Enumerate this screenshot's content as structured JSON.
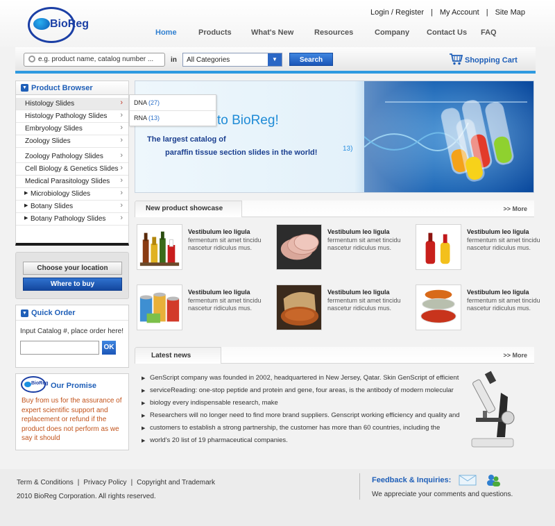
{
  "logo": {
    "text": "BioReg"
  },
  "header": {
    "toplinks": [
      "Login / Register",
      "My Account",
      "Site Map"
    ],
    "nav": [
      "Home",
      "Products",
      "What's New",
      "Resources",
      "Company",
      "Contact Us",
      "FAQ"
    ],
    "active_nav": "Home"
  },
  "search": {
    "placeholder": "e.g. product name, catalog number ...",
    "in_label": "in",
    "category_selected": "All Categories",
    "button_label": "Search"
  },
  "cart": {
    "label": "Shopping Cart"
  },
  "product_browser": {
    "title": "Product Browser",
    "items": [
      {
        "label": "Histology Slides",
        "bullet": false,
        "highlighted": true
      },
      {
        "label": "Histology Pathology Slides",
        "bullet": false
      },
      {
        "label": "Embryology Slides",
        "bullet": false
      },
      {
        "label": "Zoology Slides",
        "bullet": false
      },
      {
        "label": "Zoology Pathology Slides",
        "bullet": false
      },
      {
        "label": "Cell Biology & Genetics Slides",
        "bullet": false
      },
      {
        "label": "Medical Parasitology Slides",
        "bullet": false
      },
      {
        "label": "Microbiology Slides",
        "bullet": true
      },
      {
        "label": "Botany Slides",
        "bullet": true
      },
      {
        "label": "Botany Pathology Slides",
        "bullet": true
      }
    ],
    "flyout": [
      {
        "label": "DNA",
        "count": "(27)"
      },
      {
        "label": "RNA",
        "count": "(13)"
      }
    ]
  },
  "location": {
    "choose_label": "Choose your location",
    "where_label": "Where to buy"
  },
  "quick_order": {
    "title": "Quick Order",
    "instruction": "Input Catalog #, place order here!",
    "ok_label": "OK"
  },
  "promise": {
    "logo_text": "BioReg",
    "title": "Our Promise",
    "text": "Buy from us for the assurance of expert scientific support and replacement or refund if the product does not perform as we say it should"
  },
  "banner": {
    "title": "to BioReg!",
    "line1": "The largest catalog of",
    "line2": "paraffin tissue  section slides in the world!",
    "partial": "13)"
  },
  "showcase": {
    "title": "New product showcase",
    "more": ">> More",
    "products": [
      {
        "title": "Vestibulum leo ligula",
        "desc": "fermentum sit amet tincidu nascetur ridiculus mus.",
        "image": "bottles"
      },
      {
        "title": "Vestibulum leo ligula",
        "desc": "fermentum sit amet tincidu nascetur ridiculus mus.",
        "image": "ham-slices"
      },
      {
        "title": "Vestibulum leo ligula",
        "desc": "fermentum sit amet tincidu nascetur ridiculus mus.",
        "image": "sauce-bottles"
      },
      {
        "title": "Vestibulum leo ligula",
        "desc": "fermentum sit amet tincidu nascetur ridiculus mus.",
        "image": "cans"
      },
      {
        "title": "Vestibulum leo ligula",
        "desc": "fermentum sit amet tincidu nascetur ridiculus mus.",
        "image": "grain-sack"
      },
      {
        "title": "Vestibulum leo ligula",
        "desc": "fermentum sit amet tincidu nascetur ridiculus mus.",
        "image": "spice-bowls"
      }
    ]
  },
  "news": {
    "title": "Latest news",
    "more": ">> More",
    "lines": [
      "GenScript company was founded in 2002, headquartered in New Jersey, Qatar. Skin GenScript of efficient",
      "serviceReading: one-stop peptide and protein and gene, four areas, is the antibody of modern molecular",
      "biology every indispensable research, make",
      "Researchers will no longer need to find more brand suppliers. Genscript working efficiency and quality and",
      "customers to establish a strong partnership, the customer has more than 60  countries, including the",
      "world's 20 list of 19 pharmaceutical companies."
    ]
  },
  "footer": {
    "links": [
      "Term & Conditions",
      "Privacy Policy",
      "Copyright and Trademark"
    ],
    "copyright": "2010 BioReg Corporation. All rights reserved.",
    "feedback_title": "Feedback & Inquiries:",
    "feedback_sub": "We appreciate your comments and questions."
  },
  "colors": {
    "brand_blue": "#1f5fb8",
    "accent_blue": "#2f9ae0",
    "promise_text": "#c2531b"
  }
}
